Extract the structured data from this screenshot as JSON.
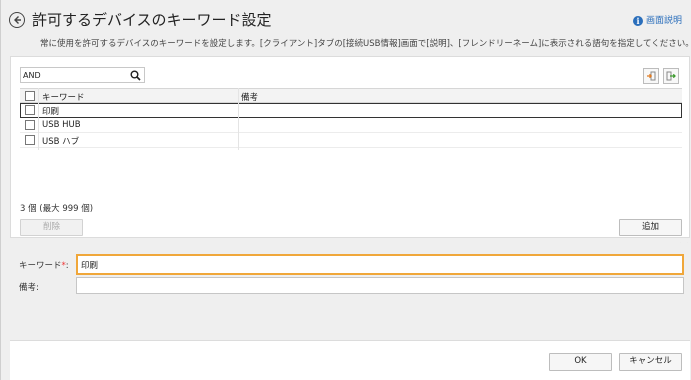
{
  "header": {
    "title": "許可するデバイスのキーワード設定",
    "help_label": "画面説明",
    "description": "常に使用を許可するデバイスのキーワードを設定します。[クライアント]タブの[接続USB情報]画面で[説明]、[フレンドリーネーム]に表示される語句を指定してください。"
  },
  "search": {
    "value": "AND"
  },
  "table": {
    "columns": [
      "キーワード",
      "備考"
    ],
    "rows": [
      {
        "keyword": "印刷",
        "note": ""
      },
      {
        "keyword": "USB HUB",
        "note": ""
      },
      {
        "keyword": "USB ハブ",
        "note": ""
      }
    ]
  },
  "list_footer": {
    "count_text": "3 個 (最大 999 個)",
    "delete_label": "削除",
    "add_label": "追加"
  },
  "form": {
    "keyword_label": "キーワード",
    "required_mark": "*",
    "keyword_colon": ":",
    "keyword_value": "印刷",
    "note_label": "備考:",
    "note_value": ""
  },
  "footer": {
    "ok_label": "OK",
    "cancel_label": "キャンセル"
  },
  "colors": {
    "focus_border": "#f0a73a",
    "link": "#2a6ebb",
    "required": "#ee3333"
  }
}
